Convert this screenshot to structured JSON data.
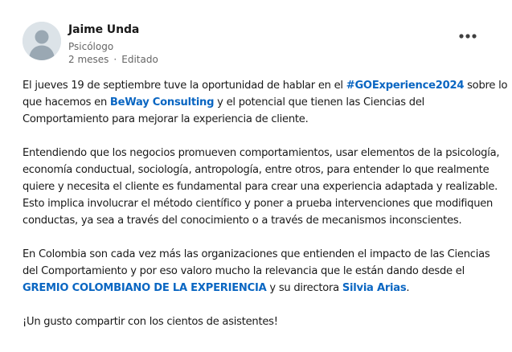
{
  "author": {
    "name": "Jaime Unda",
    "headline": "Psicólogo",
    "time_ago": "2 meses",
    "separator": "·",
    "edited_label": "Editado"
  },
  "post": {
    "p1": {
      "l1a": "El jueves 19 de septiembre tuve la oportunidad de hablar en el ",
      "hashtag": "#GOExperience2024",
      "l1b": " sobre lo",
      "l2a": "que hacemos en ",
      "company": "BeWay Consulting",
      "l2b": " y el potencial que tienen las Ciencias del",
      "l3": "Comportamiento para mejorar la experiencia de cliente."
    },
    "p2": {
      "l1": "Entendiendo que los negocios promueven comportamientos, usar elementos de la psicología,",
      "l2": "economía conductual, sociología, antropología, entre otros, para entender lo que realmente",
      "l3": "quiere y necesita el cliente es fundamental para crear una experiencia adaptada y realizable.",
      "l4": "Esto implica involucrar el método científico y poner a prueba intervenciones que modifiquen",
      "l5": "conductas, ya sea a través del conocimiento o a través de mecanismos inconscientes."
    },
    "p3": {
      "l1": "En Colombia son cada vez más las organizaciones que entienden el impacto de las Ciencias",
      "l2": "del Comportamiento y por eso valoro mucho la relevancia que le están dando desde el",
      "org": "GREMIO COLOMBIANO DE LA EXPERIENCIA",
      "l3b": " y su directora ",
      "person": "Silvia Arias",
      "l3c": "."
    },
    "p4": {
      "l1": "¡Un gusto compartir con los cientos de asistentes!"
    }
  },
  "colors": {
    "link": "#0a66c2",
    "text": "#191919",
    "muted": "#666666"
  },
  "icons": {
    "more": "more-horizontal-icon",
    "avatar": "person-placeholder-icon"
  }
}
